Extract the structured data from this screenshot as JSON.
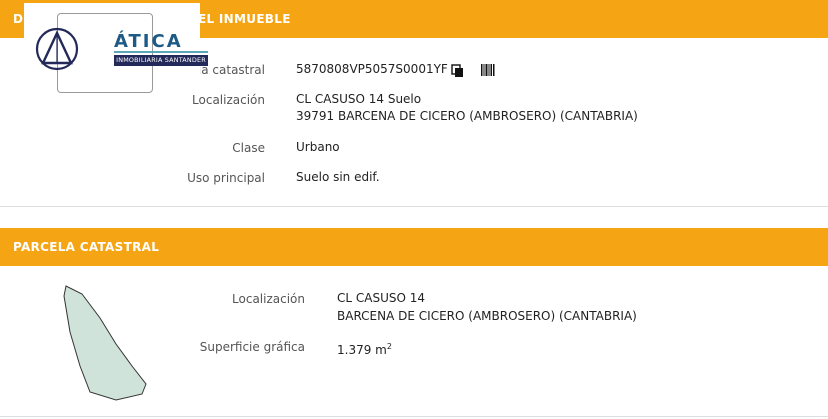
{
  "header1": {
    "title_left": "D",
    "title_right": "EL INMUEBLE"
  },
  "logo": {
    "word": "ÁTICA",
    "tagline": "INMOBILIARIA SANTANDER"
  },
  "inmueble": {
    "ref_label": "ia catastral",
    "ref_value": "5870808VP5057S0001YF",
    "loc_label": "Localización",
    "loc_line1": "CL CASUSO 14 Suelo",
    "loc_line2": "39791 BARCENA DE CICERO (AMBROSERO) (CANTABRIA)",
    "clase_label": "Clase",
    "clase_value": "Urbano",
    "uso_label": "Uso principal",
    "uso_value": "Suelo sin edif."
  },
  "header2": {
    "title": "PARCELA CATASTRAL"
  },
  "parcela": {
    "loc_label": "Localización",
    "loc_line1": "CL CASUSO 14",
    "loc_line2": "BARCENA DE CICERO (AMBROSERO) (CANTABRIA)",
    "sup_label": "Superficie gráfica",
    "sup_value": "1.379 m",
    "sup_unit_exp": "2"
  },
  "icons": {
    "copy": "copy-icon",
    "barcode": "barcode-icon",
    "logo_mark": "triangle-logo-icon"
  },
  "colors": {
    "header_bg": "#f5a514",
    "logo_blue": "#1d5b86",
    "logo_navy": "#232958",
    "parcel_fill": "#cfe3da"
  }
}
